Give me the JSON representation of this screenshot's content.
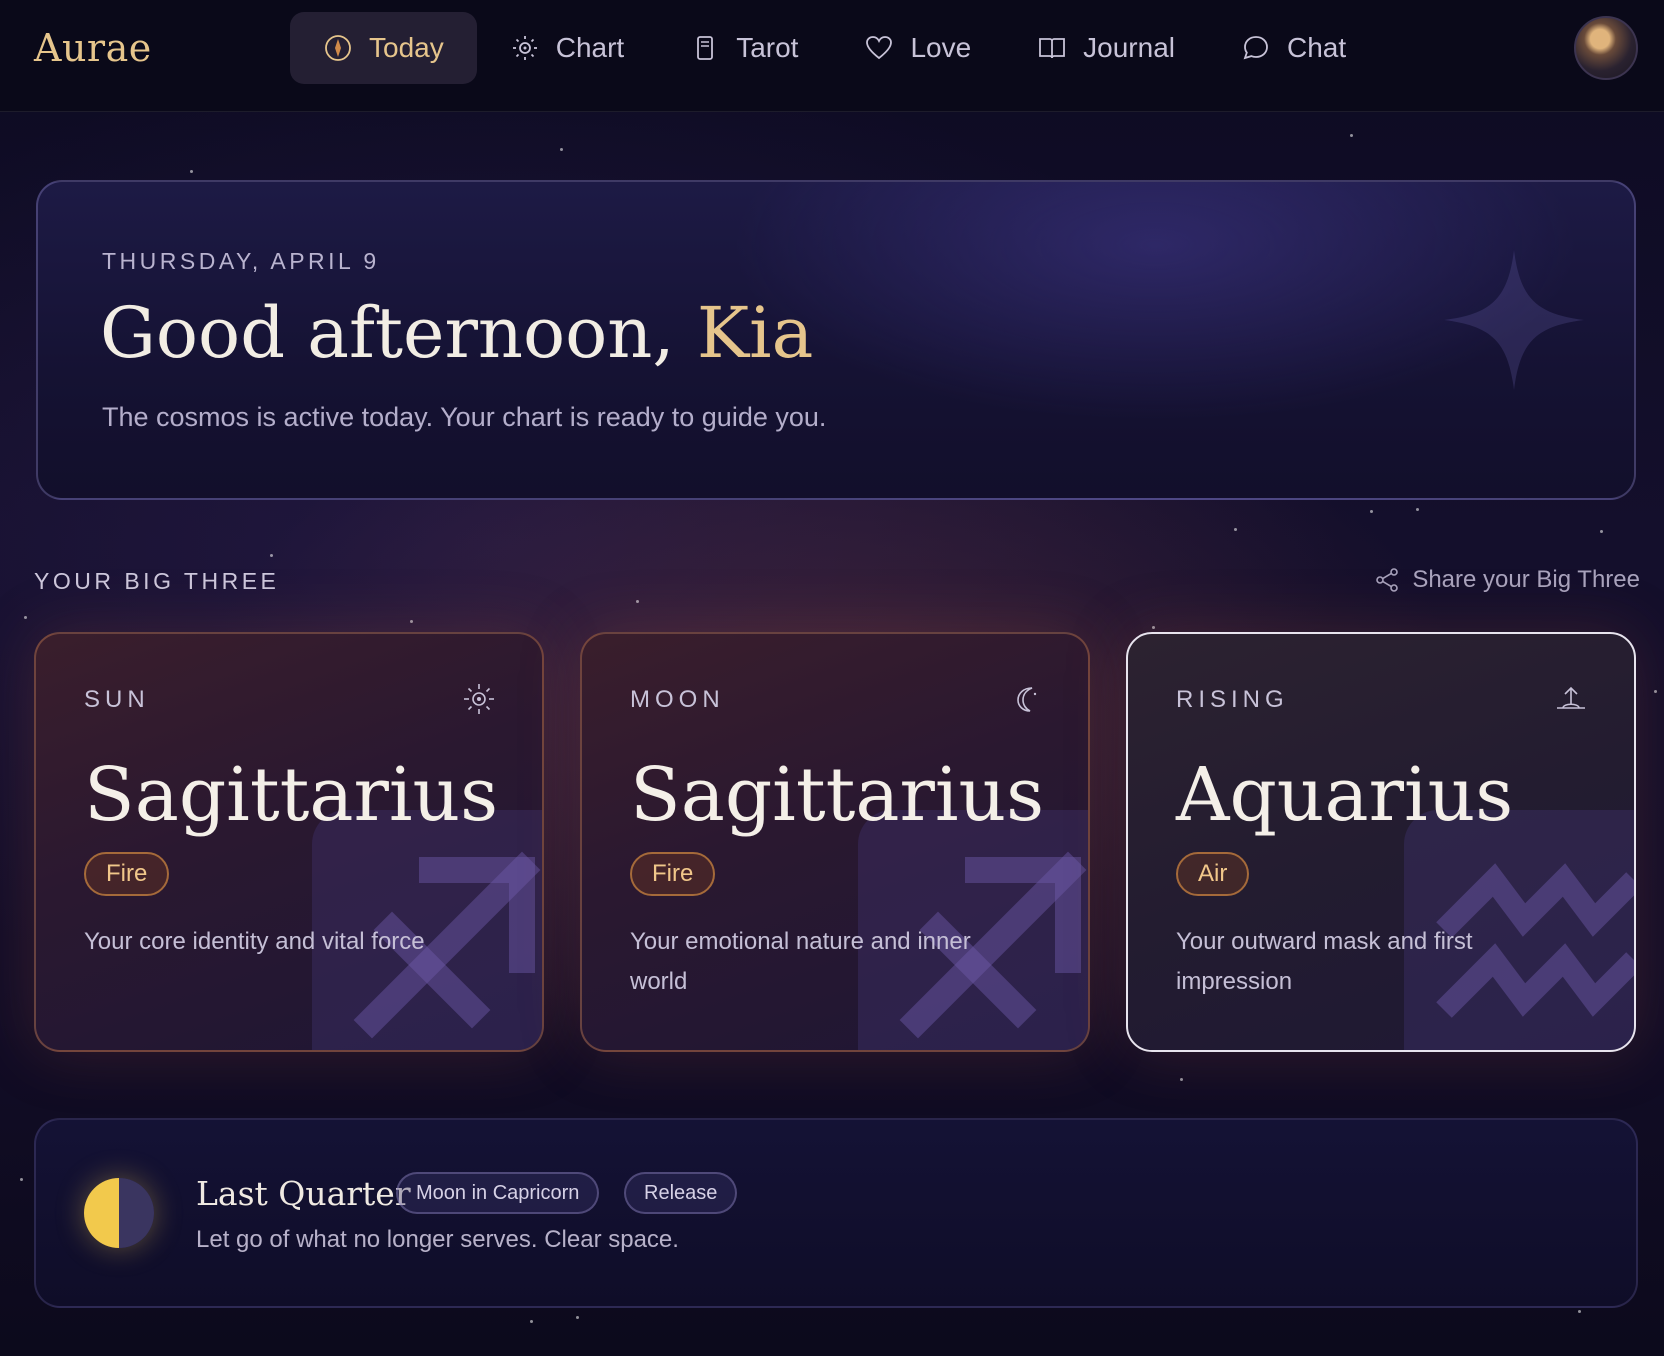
{
  "app": {
    "logo": "Aurae"
  },
  "nav": {
    "items": [
      {
        "label": "Today",
        "icon": "compass-icon",
        "active": true
      },
      {
        "label": "Chart",
        "icon": "sun-chart-icon",
        "active": false
      },
      {
        "label": "Tarot",
        "icon": "card-icon",
        "active": false
      },
      {
        "label": "Love",
        "icon": "heart-icon",
        "active": false
      },
      {
        "label": "Journal",
        "icon": "book-icon",
        "active": false
      },
      {
        "label": "Chat",
        "icon": "chat-bubble-icon",
        "active": false
      }
    ]
  },
  "hero": {
    "date": "THURSDAY, APRIL 9",
    "greeting": "Good afternoon, ",
    "name": "Kia",
    "subtitle": "The cosmos is active today. Your chart is ready to guide you."
  },
  "big_three": {
    "label": "YOUR BIG THREE",
    "share_label": "Share your Big Three",
    "cards": [
      {
        "label": "SUN",
        "sign": "Sagittarius",
        "element": "Fire",
        "description": "Your core identity and vital force",
        "icon": "sun-icon",
        "glyph": "sagittarius-glyph"
      },
      {
        "label": "MOON",
        "sign": "Sagittarius",
        "element": "Fire",
        "description": "Your emotional nature and inner world",
        "icon": "moon-icon",
        "glyph": "sagittarius-glyph"
      },
      {
        "label": "RISING",
        "sign": "Aquarius",
        "element": "Air",
        "description": "Your outward mask and first impression",
        "icon": "sunrise-icon",
        "glyph": "aquarius-glyph"
      }
    ]
  },
  "moon_phase": {
    "title": "Last Quarter",
    "chips": [
      "Moon in Capricorn",
      "Release"
    ],
    "description": "Let go of what no longer serves. Clear space."
  },
  "colors": {
    "accent_gold": "#e6c58c",
    "background": "#0d0b22",
    "element_chip_border": "#a56a3a"
  }
}
